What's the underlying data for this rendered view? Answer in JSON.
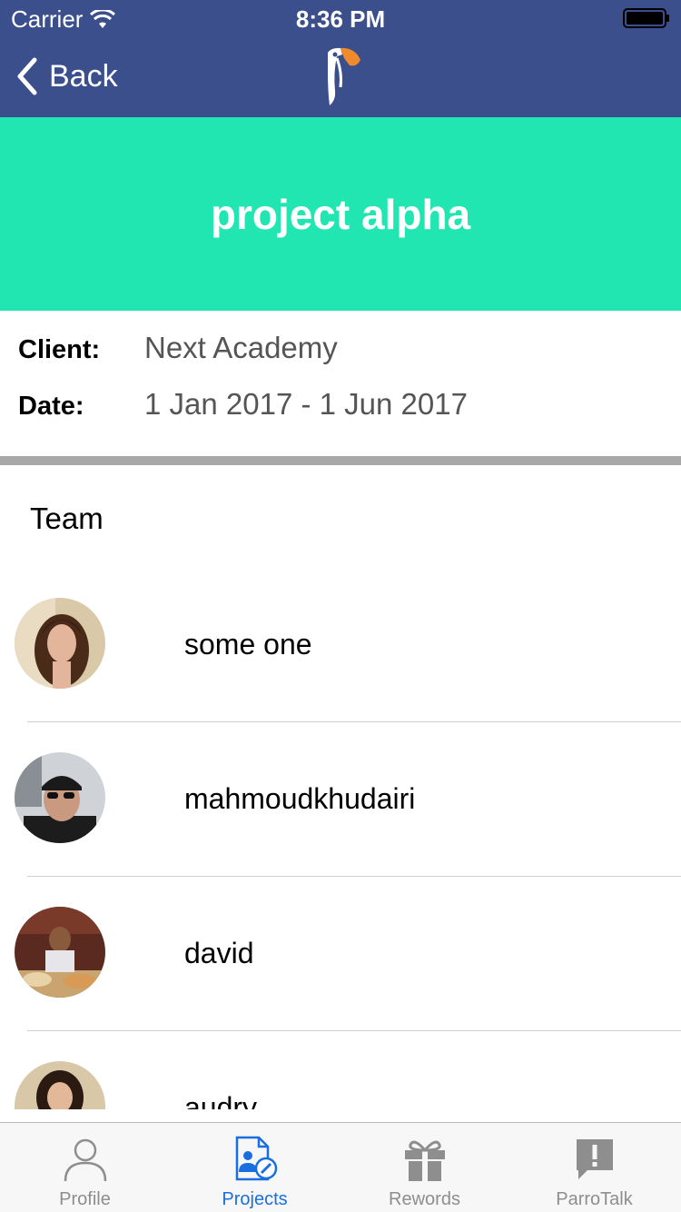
{
  "status_bar": {
    "carrier": "Carrier",
    "time": "8:36 PM"
  },
  "nav": {
    "back_label": "Back"
  },
  "project": {
    "title": "project alpha"
  },
  "details": {
    "client_label": "Client:",
    "client_value": "Next Academy",
    "date_label": "Date:",
    "date_value": "1 Jan 2017 - 1 Jun 2017"
  },
  "team": {
    "title": "Team",
    "members": [
      {
        "name": "some one"
      },
      {
        "name": "mahmoudkhudairi"
      },
      {
        "name": "david"
      },
      {
        "name": "audry"
      }
    ]
  },
  "tabs": [
    {
      "label": "Profile",
      "icon": "person-icon",
      "active": false
    },
    {
      "label": "Projects",
      "icon": "projects-icon",
      "active": true
    },
    {
      "label": "Rewords",
      "icon": "gift-icon",
      "active": false
    },
    {
      "label": "ParroTalk",
      "icon": "alert-bubble-icon",
      "active": false
    }
  ],
  "colors": {
    "nav_bg": "#3b4f8c",
    "banner_bg": "#21e6b1",
    "active_tab": "#1a6fe0",
    "inactive_tab": "#8e8e8e",
    "logo_orange": "#f08a2c"
  }
}
